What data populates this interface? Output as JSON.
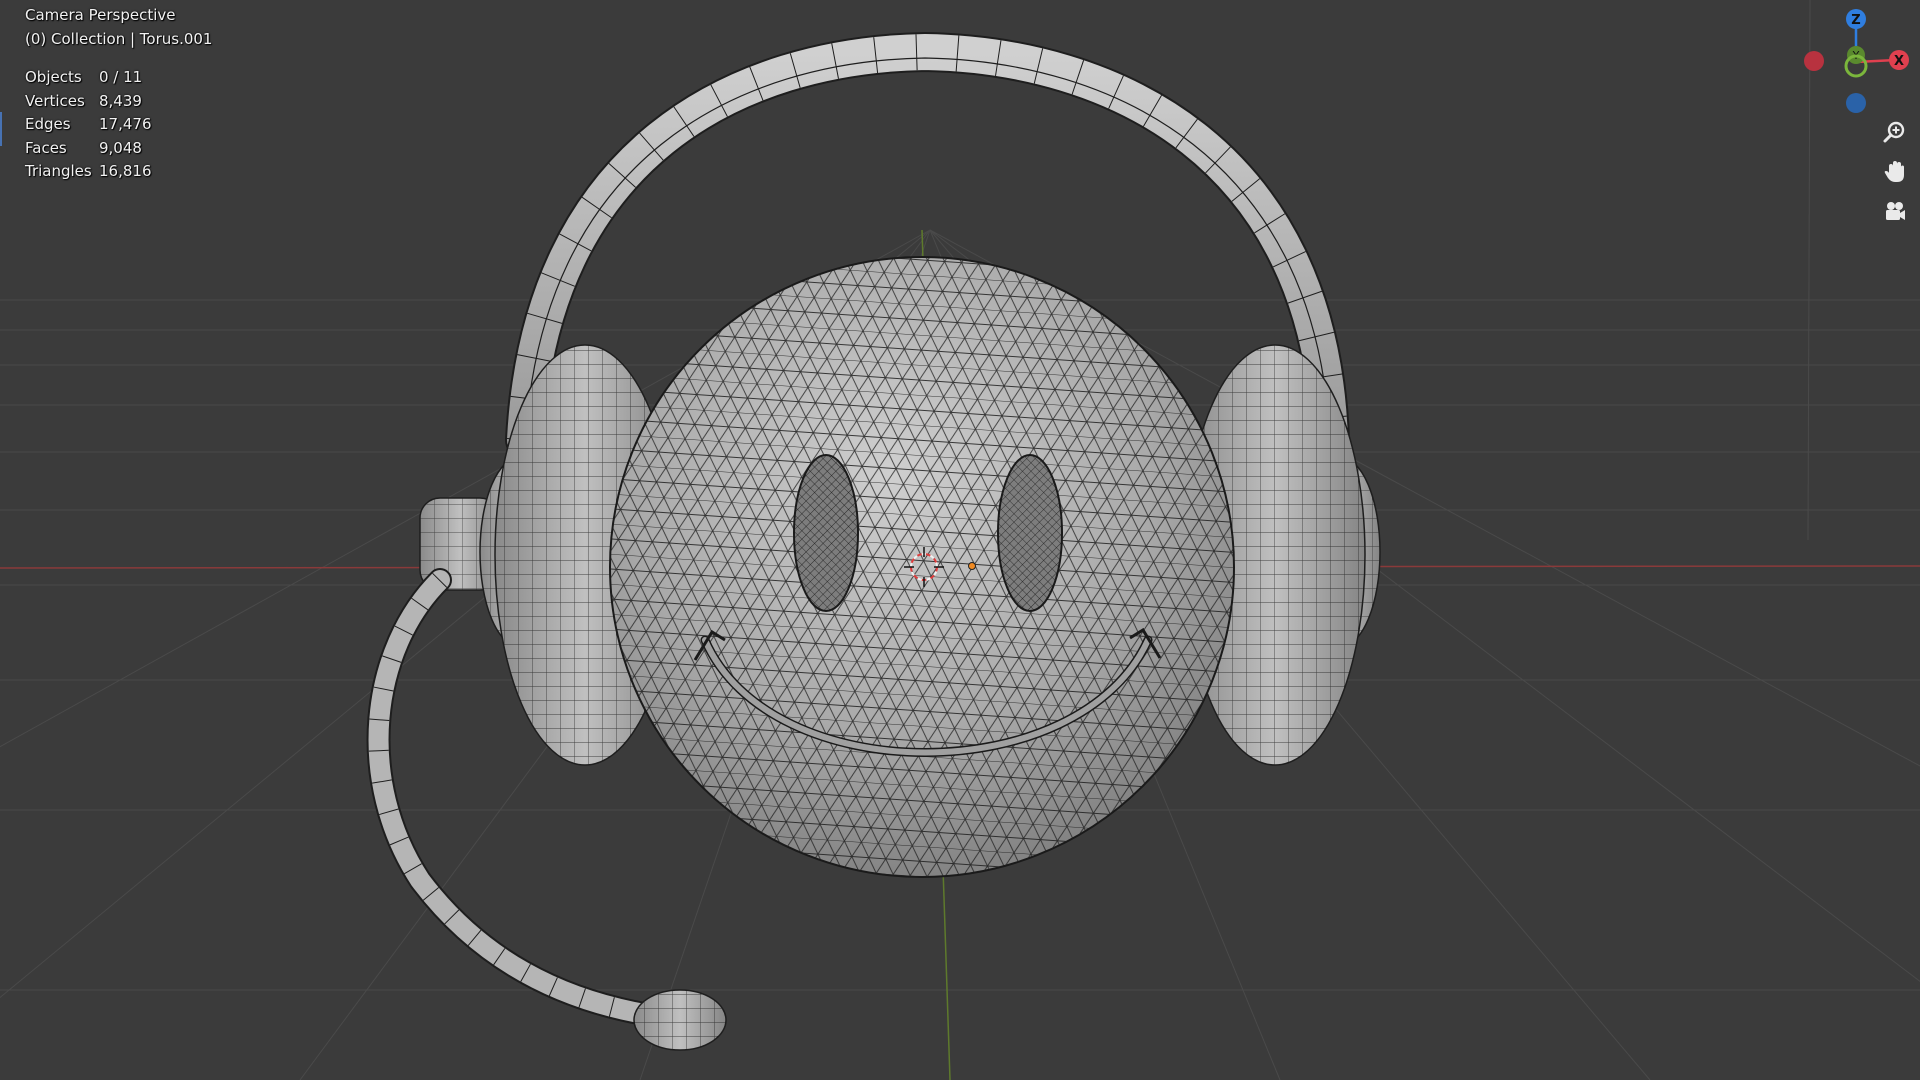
{
  "viewport": {
    "view_name": "Camera Perspective",
    "collection_info": "(0) Collection | Torus.001"
  },
  "stats": [
    {
      "label": "Objects",
      "value": "0 / 11"
    },
    {
      "label": "Vertices",
      "value": "8,439"
    },
    {
      "label": "Edges",
      "value": "17,476"
    },
    {
      "label": "Faces",
      "value": "9,048"
    },
    {
      "label": "Triangles",
      "value": "16,816"
    }
  ],
  "gizmo": {
    "z_label": "Z",
    "x_label": "X",
    "y_label": "Y",
    "colors": {
      "x": "#e0404f",
      "y": "#7bb63c",
      "z": "#2f7ee0",
      "neg_x": "#b8323f",
      "neg_y": "#5a8a2e",
      "neg_z": "#2a62a8"
    }
  },
  "nav_icons": {
    "zoom": "zoom-in-icon",
    "pan": "hand-pan-icon",
    "camera": "camera-view-icon"
  },
  "colors": {
    "background": "#3b3b3b",
    "grid": "#4a4a4a",
    "x_axis": "#8a3a3a",
    "y_axis": "#5e7a2c",
    "mesh_fill": "#a8a8a8",
    "wire": "#1e1e1e"
  }
}
